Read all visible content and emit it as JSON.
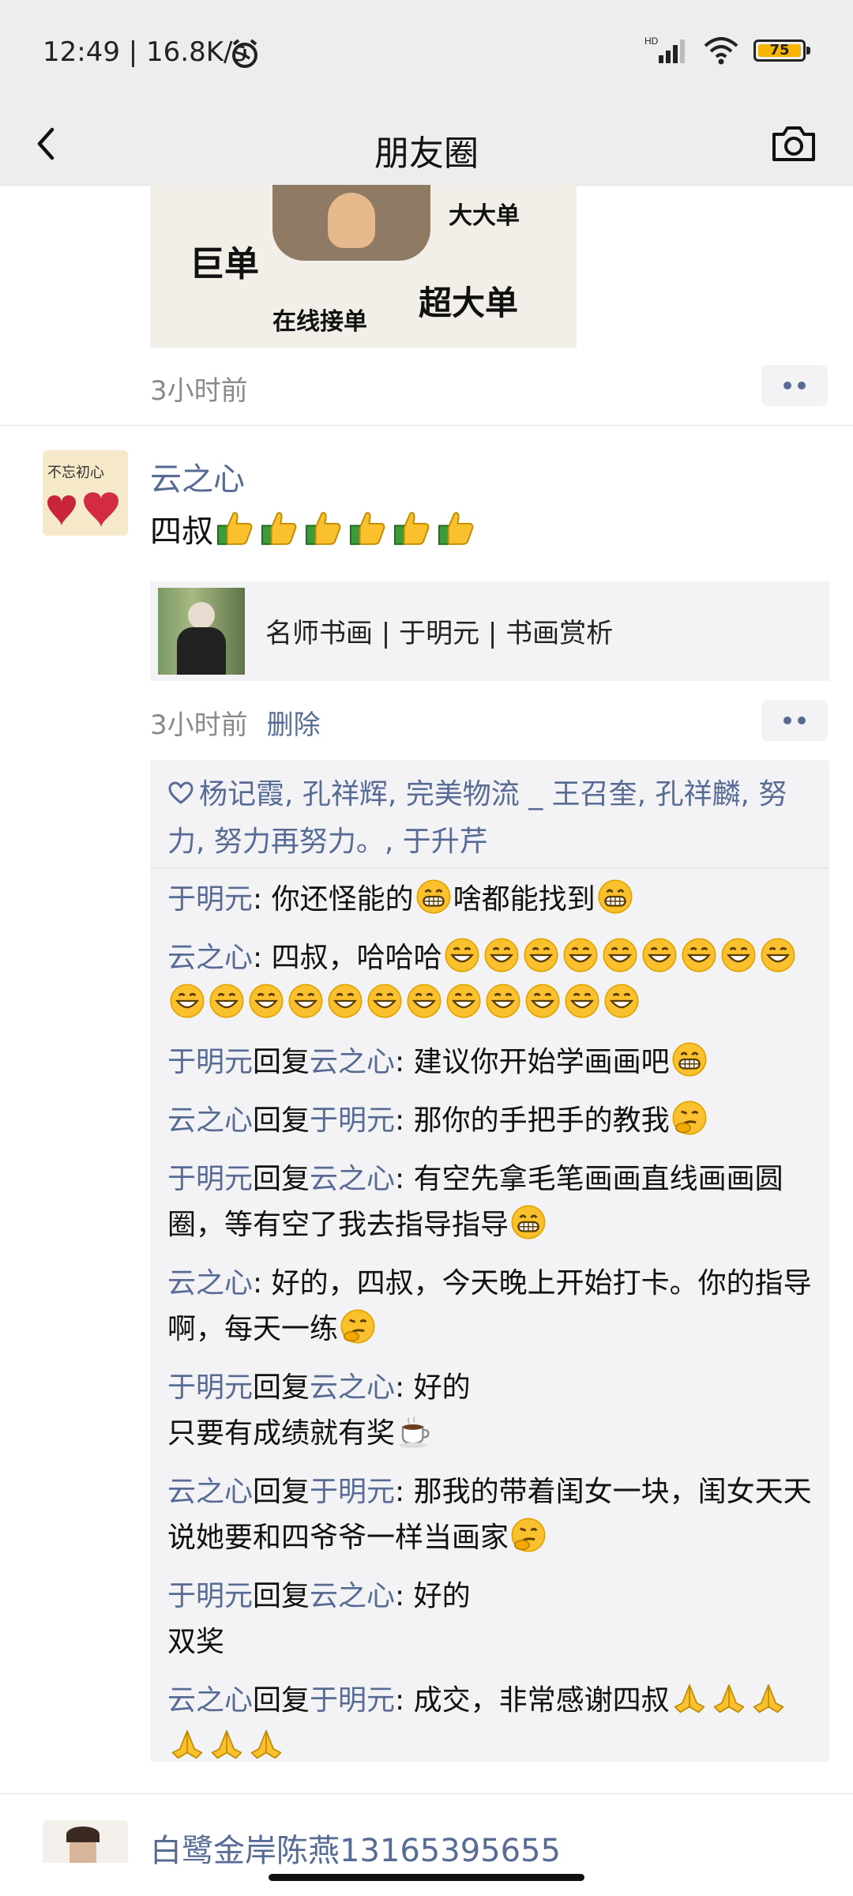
{
  "status_bar": {
    "time": "12:49 | 16.8K/s",
    "network": "HD",
    "battery": "75"
  },
  "nav": {
    "title": "朋友圈"
  },
  "prev_post": {
    "image_texts": [
      "大大单",
      "巨单",
      "超大单",
      "在线接单"
    ],
    "time": "3小时前"
  },
  "post": {
    "author": "云之心",
    "avatar_texts": [
      "不忘初心"
    ],
    "text": "四叔",
    "thumbs_count": 6,
    "link_title": "名师书画 | 于明元 | 书画赏析",
    "time": "3小时前",
    "delete_label": "删除",
    "likes": "杨记霞, 孔祥辉, 完美物流 _ 王召奎, 孔祥麟, 努力, 努力再努力。, 于升芹",
    "comments": [
      {
        "from": "于明元",
        "to": "",
        "text": ": 你还怪能的",
        "emojis": [
          "grin"
        ],
        "text2": "啥都能找到",
        "emojis2": [
          "grin"
        ]
      },
      {
        "from": "云之心",
        "to": "",
        "text": ": 四叔，哈哈哈",
        "emojis": [
          "smile",
          "smile",
          "smile",
          "smile",
          "smile",
          "smile",
          "smile",
          "smile",
          "smile",
          "smile",
          "smile",
          "smile",
          "smile",
          "smile",
          "smile",
          "smile",
          "smile",
          "smile",
          "smile",
          "smile",
          "smile"
        ]
      },
      {
        "from": "于明元",
        "to": "云之心",
        "text": ": 建议你开始学画画吧",
        "emojis": [
          "grin"
        ]
      },
      {
        "from": "云之心",
        "to": "于明元",
        "text": ": 那你的手把手的教我",
        "emojis": [
          "think"
        ]
      },
      {
        "from": "于明元",
        "to": "云之心",
        "text": ": 有空先拿毛笔画画直线画画圆圈，等有空了我去指导指导",
        "emojis": [
          "grin"
        ]
      },
      {
        "from": "云之心",
        "to": "",
        "text": ": 好的，四叔，今天晚上开始打卡。你的指导啊，每天一练",
        "emojis": [
          "think"
        ]
      },
      {
        "from": "于明元",
        "to": "云之心",
        "text": ": 好的\n只要有成绩就有奖",
        "emojis": [
          "coffee"
        ]
      },
      {
        "from": "云之心",
        "to": "于明元",
        "text": ": 那我的带着闺女一块，闺女天天说她要和四爷爷一样当画家",
        "emojis": [
          "think"
        ]
      },
      {
        "from": "于明元",
        "to": "云之心",
        "text": ": 好的\n双奖",
        "emojis": []
      },
      {
        "from": "云之心",
        "to": "于明元",
        "text": ": 成交，非常感谢四叔",
        "emojis": [
          "pray",
          "pray",
          "pray",
          "pray",
          "pray",
          "pray"
        ]
      }
    ],
    "reply_word": "回复"
  },
  "next_post": {
    "author": "白鹭金岸陈燕13165395655"
  },
  "colors": {
    "link_blue": "#576b95",
    "comment_bg": "#f3f3f5",
    "nav_bg": "#ededed"
  }
}
